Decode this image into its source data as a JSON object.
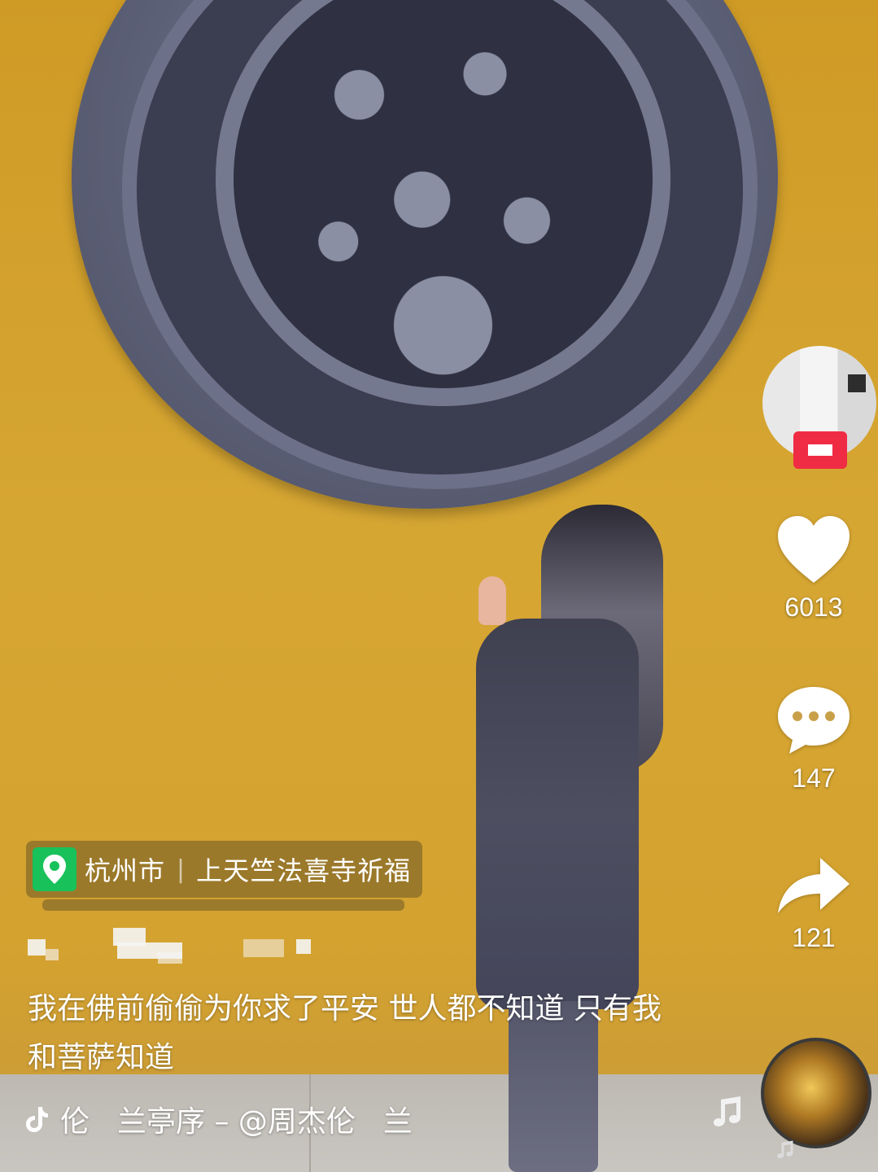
{
  "location": {
    "city": "杭州市",
    "place": "上天竺法喜寺祈福"
  },
  "caption": "我在佛前偷偷为你求了平安 世人都不知道 只有我和菩萨知道",
  "music": {
    "text_left": "伦",
    "text_main": "兰亭序 – @周杰伦",
    "text_right": "兰"
  },
  "actions": {
    "likes": "6013",
    "comments": "147",
    "shares": "121"
  },
  "colors": {
    "wall": "#d39f2b",
    "location_icon": "#19c15a",
    "follow_badge": "#f02c44"
  },
  "icons": {
    "like": "heart-icon",
    "comment": "comment-bubble-icon",
    "share": "share-arrow-icon",
    "location": "location-pin-icon",
    "music": "music-note-icon",
    "brand": "tiktok-logo-icon"
  }
}
